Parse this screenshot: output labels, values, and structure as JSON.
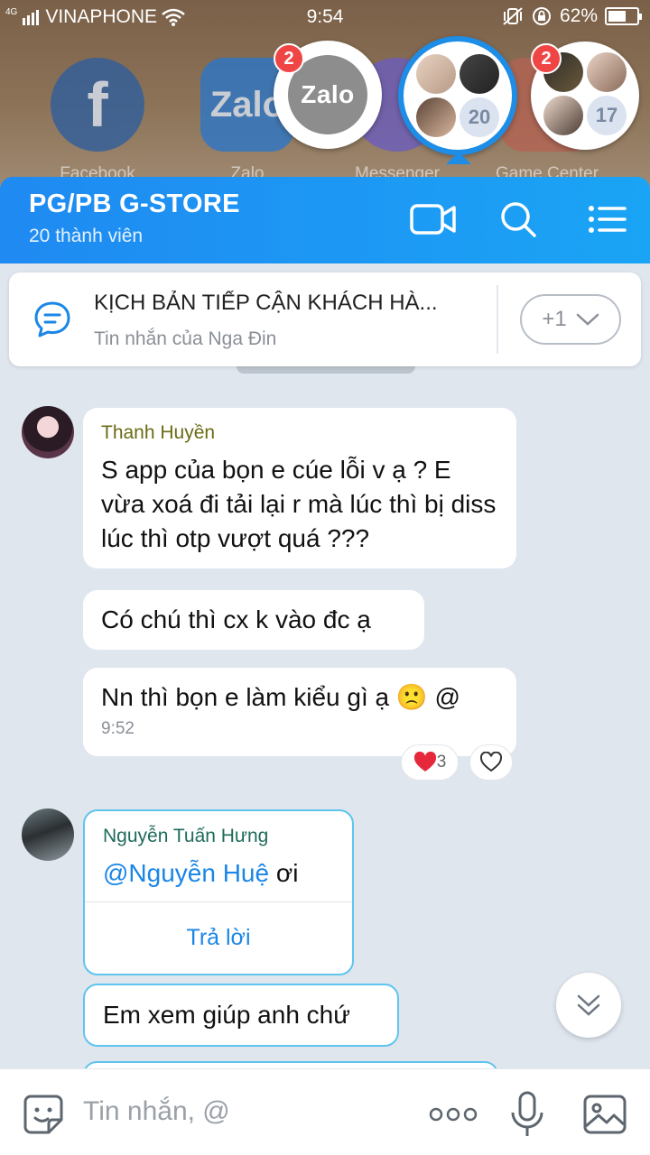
{
  "status_bar": {
    "network_type": "4G",
    "carrier": "VINAPHONE",
    "time": "9:54",
    "battery_percent": "62%",
    "battery_level": 0.62
  },
  "home_apps": [
    {
      "label": "Facebook",
      "icon": "facebook-icon"
    },
    {
      "label": "Zalo",
      "icon": "zalo-icon"
    },
    {
      "label": "Messenger",
      "icon": "messenger-icon"
    },
    {
      "label": "Game Center",
      "icon": "game-center-icon"
    }
  ],
  "chat_heads": {
    "zalo": {
      "label": "Zalo",
      "badge": "2"
    },
    "group": {
      "member_count": "20"
    },
    "other_group": {
      "member_count": "17",
      "badge": "2"
    }
  },
  "header": {
    "title": "PG/PB G-STORE",
    "subtitle": "20 thành viên"
  },
  "pinned": {
    "title": "KỊCH BẢN TIẾP CẬN KHÁCH HÀ...",
    "subtitle": "Tin nhắn của Nga Đin",
    "more_count": "+1"
  },
  "messages": [
    {
      "sender": "Thanh Huyền",
      "text": "S app của bọn e cúe lỗi v ạ ? E vừa xoá đi tải lại r mà lúc thì bị diss lúc thì otp  vượt quá ???"
    },
    {
      "text": "Có chú thì cx k vào đc ạ"
    },
    {
      "text": "Nn thì bọn e làm kiểu gì ạ",
      "emoji": "🙁",
      "trail": " @",
      "time": "9:52",
      "reaction_count": "3"
    },
    {
      "sender": "Nguyễn Tuấn Hưng",
      "mention": "@Nguyễn Huệ",
      "text": " ơi",
      "reply_label": "Trả lời"
    },
    {
      "text": "Em xem giúp anh chứ"
    }
  ],
  "input": {
    "placeholder": "Tin nhắn, @"
  },
  "colors": {
    "header_blue": "#1f8af2",
    "mention_blue": "#1a86e6",
    "sender_huyen": "#6b6b14",
    "sender_hung": "#1e6b5b"
  }
}
